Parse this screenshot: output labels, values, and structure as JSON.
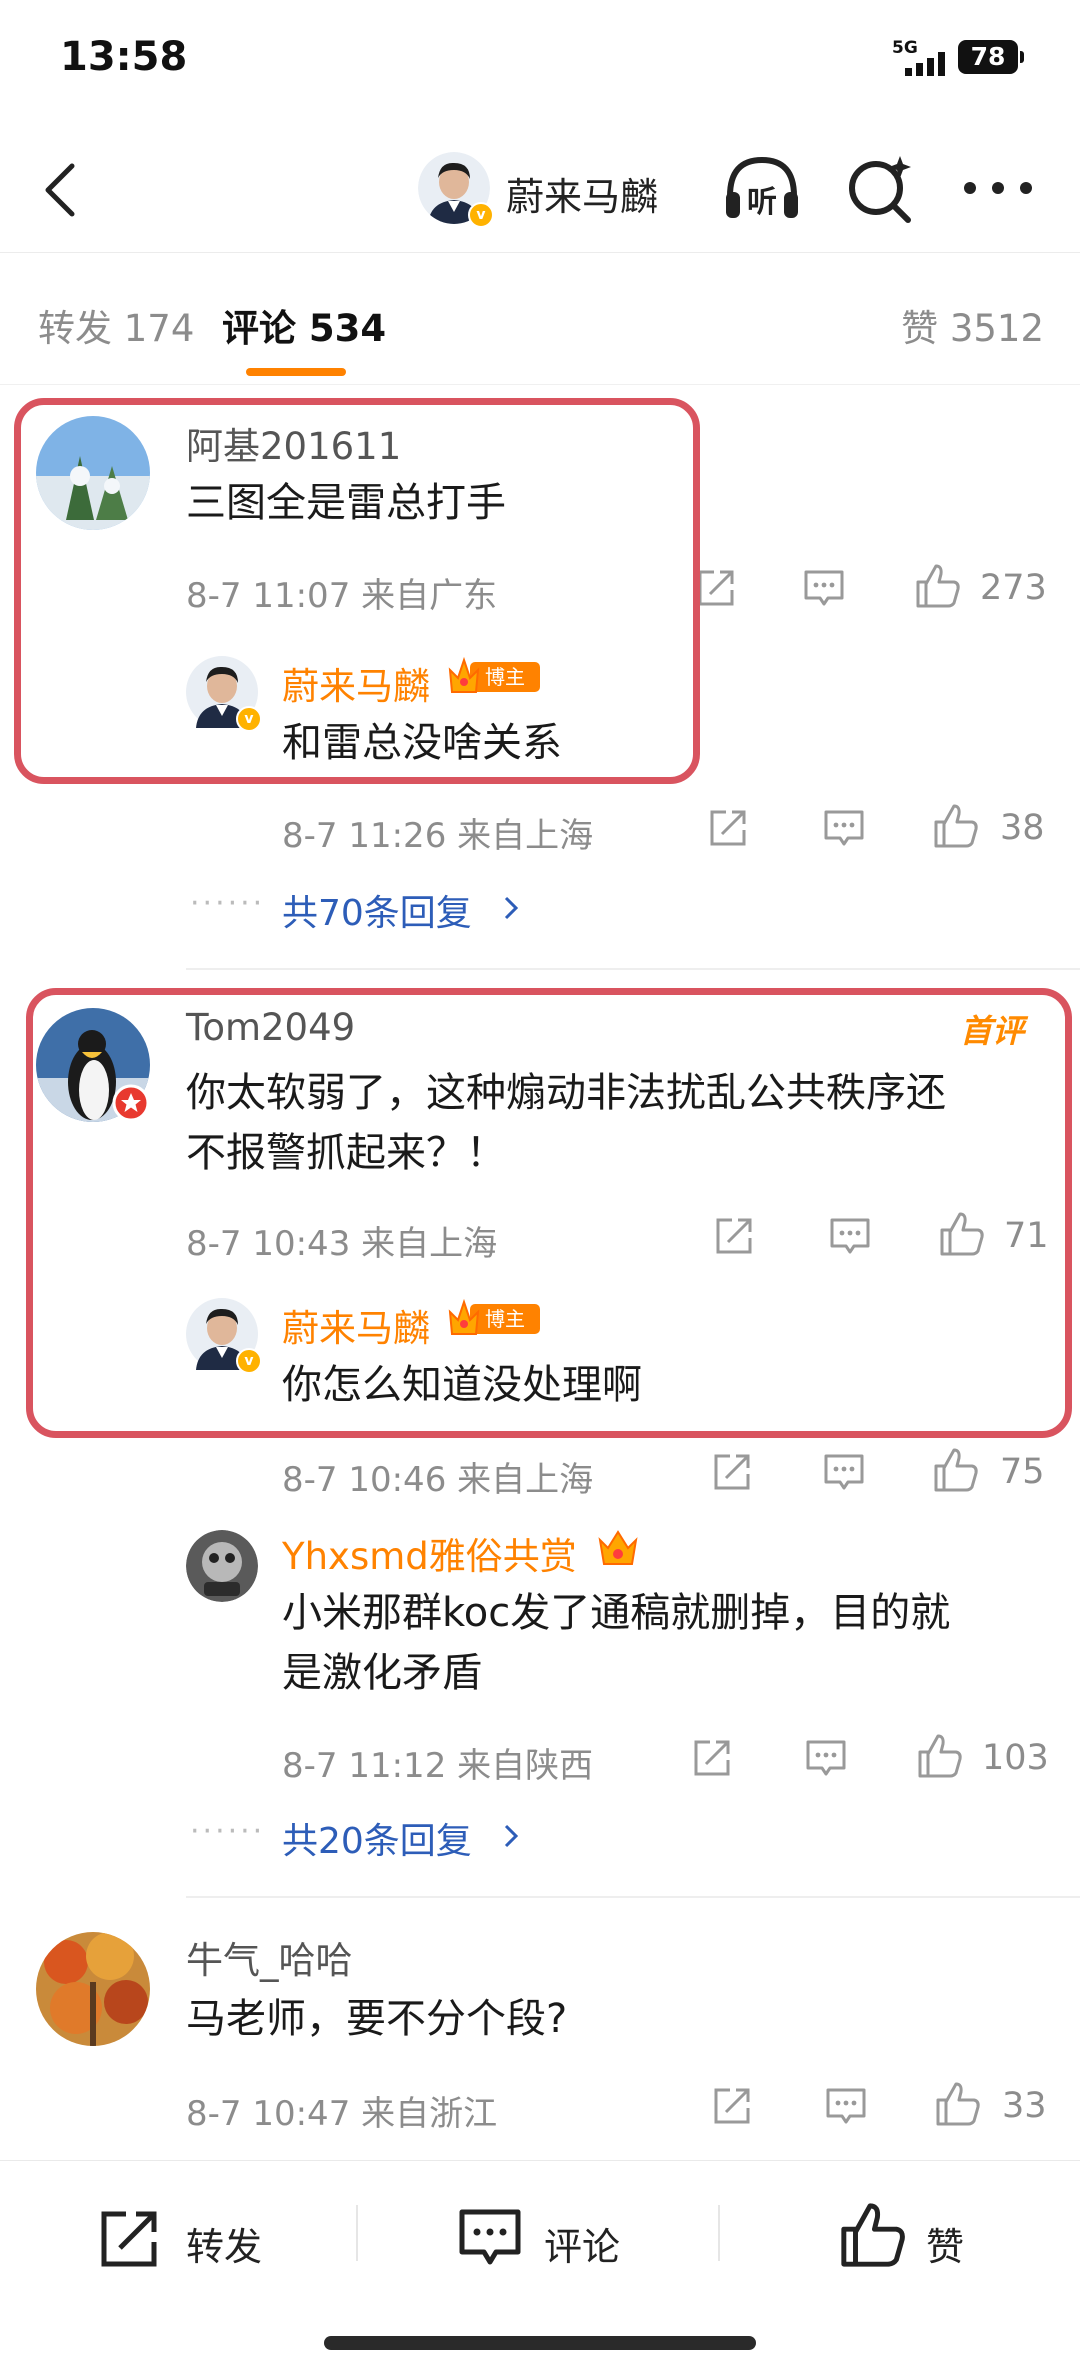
{
  "status_bar": {
    "time": "13:58",
    "network": "5G",
    "battery": "78"
  },
  "header": {
    "title": "蔚来马麟",
    "listen_label": "听"
  },
  "tabs": {
    "repost": "转发 174",
    "comment": "评论 534",
    "likes": "赞 3512"
  },
  "comments": [
    {
      "user": "阿基201611",
      "text": "三图全是雷总打手",
      "meta": "8-7 11:07  来自广东",
      "likes": "273",
      "reply": {
        "user": "蔚来马麟",
        "badge": "博主",
        "text": "和雷总没啥关系",
        "meta": "8-7 11:26  来自上海",
        "likes": "38"
      },
      "more_replies": "共70条回复"
    },
    {
      "user": "Tom2049",
      "tag": "首评",
      "text_line1": "你太软弱了，这种煽动非法扰乱公共秩序还",
      "text_line2": "不报警抓起来？！",
      "meta": "8-7 10:43  来自上海",
      "likes": "71",
      "reply": {
        "user": "蔚来马麟",
        "badge": "博主",
        "text": "你怎么知道没处理啊",
        "meta": "8-7 10:46  来自上海",
        "likes": "75"
      },
      "reply2": {
        "user": "Yhxsmd雅俗共赏",
        "text_line1": "小米那群koc发了通稿就删掉，目的就",
        "text_line2": "是激化矛盾",
        "meta": "8-7 11:12  来自陕西",
        "likes": "103"
      },
      "more_replies": "共20条回复"
    },
    {
      "user": "牛气_哈哈",
      "text": "马老师，要不分个段?",
      "meta": "8-7 10:47  来自浙江",
      "likes": "33"
    }
  ],
  "bottom_bar": {
    "repost": "转发",
    "comment": "评论",
    "like": "赞"
  },
  "colors": {
    "accent": "#ff8200",
    "highlight_box": "#d9545f",
    "link": "#2d5db8"
  }
}
